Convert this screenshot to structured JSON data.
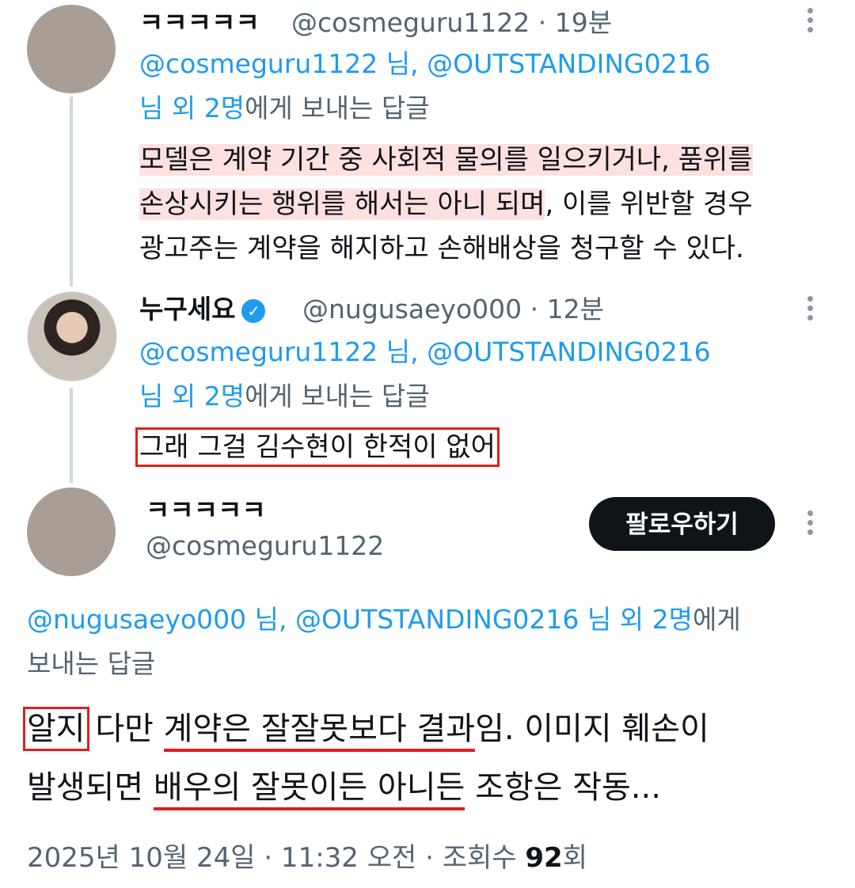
{
  "thread": {
    "tweet1": {
      "display_name": "ㅋㅋㅋㅋㅋ",
      "handle": "@cosmeguru1122",
      "time": "19분",
      "reply_mentions": "@cosmeguru1122 님, @OUTSTANDING0216",
      "reply_mentions2": "님 외 2명",
      "reply_suffix": "에게 보내는 답글",
      "line1_hl": "모델은 계약 기간 중 사회적 물의를 일으키거나, 품위를",
      "line2_hl": "손상시키는 행위를 해서는 아니 되며",
      "line2_rest": ", 이를 위반할 경우",
      "line3": "광고주는 계약을 해지하고 손해배상을 청구할 수 있다."
    },
    "tweet2": {
      "display_name": "누구세요",
      "verified": true,
      "handle": "@nugusaeyo000",
      "time": "12분",
      "reply_mentions": "@cosmeguru1122 님, @OUTSTANDING0216",
      "reply_mentions2": "님 외 2명",
      "reply_suffix": "에게 보내는 답글",
      "text": "그래 그걸 김수현이 한적이 없어"
    },
    "main_tweet": {
      "display_name": "ㅋㅋㅋㅋㅋ",
      "handle": "@cosmeguru1122",
      "follow_label": "팔로우하기",
      "reply_mentions": "@nugusaeyo000 님, @OUTSTANDING0216 님 외 2명",
      "reply_suffix_cut": "에게",
      "reply_suffix2": "보내는 답글",
      "body": {
        "w1": "알지",
        "w2": " 다만 ",
        "w3": "계약은 잘잘못보다 결과",
        "w4": "임. 이미지 훼손이",
        "w5": "발생되면 ",
        "w6": "배우의 잘못이든 아니든",
        "w7": " 조항은 작동..."
      },
      "date": "2025년 10월 24일 · 11:32 오전 · 조회수 ",
      "views": "92",
      "views_unit": "회"
    }
  }
}
